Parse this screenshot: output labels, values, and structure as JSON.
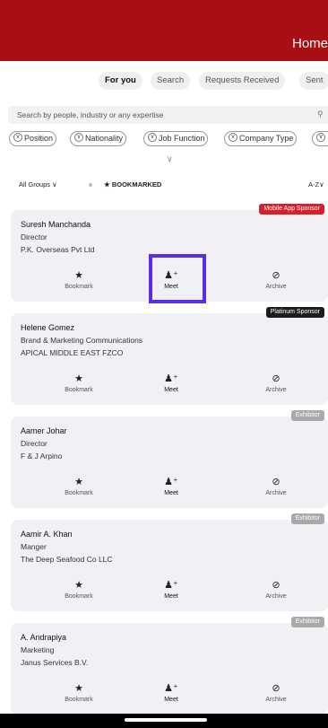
{
  "header": {
    "title": "Home"
  },
  "tabs": [
    {
      "label": "For you",
      "active": true
    },
    {
      "label": "Search",
      "active": false
    },
    {
      "label": "Requests Received",
      "active": false
    },
    {
      "label": "Sent",
      "active": false
    }
  ],
  "search": {
    "placeholder": "Search by people, industry or any expertise",
    "icon": "search-icon"
  },
  "filters": [
    {
      "label": "Position"
    },
    {
      "label": "Nationality"
    },
    {
      "label": "Job Function"
    },
    {
      "label": "Company Type"
    }
  ],
  "groupbar": {
    "group": "All Groups",
    "bookmarked": "BOOKMARKED",
    "sort": "A-Z"
  },
  "actions": {
    "bookmark": "Bookmark",
    "meet": "Meet",
    "archive": "Archive"
  },
  "colors": {
    "brand": "#a80f14",
    "highlight": "#5b2ee6",
    "badge_sponsor": "#d8202a",
    "badge_platinum": "#1c1c1c",
    "badge_exhibitor": "#a9a9a9"
  },
  "cards": [
    {
      "badge": "Mobile App Sponsor",
      "name": "Suresh Manchanda",
      "title": "Director",
      "company": "P.K. Overseas Pvt Ltd"
    },
    {
      "badge": "Platinum Sponsor",
      "name": "Helene Gomez",
      "title": "Brand & Marketing Communications",
      "company": "APICAL MIDDLE EAST FZCO"
    },
    {
      "badge": "Exhibitor",
      "name": "Aamer Johar",
      "title": "Director",
      "company": "F & J Arpino"
    },
    {
      "badge": "Exhibitor",
      "name": "Aamir A. Khan",
      "title": "Manger",
      "company": "The Deep Seafood Co LLC"
    },
    {
      "badge": "Exhibitor",
      "name": "A. Andrapiya",
      "title": "Marketing",
      "company": "Janus Services B.V."
    }
  ]
}
